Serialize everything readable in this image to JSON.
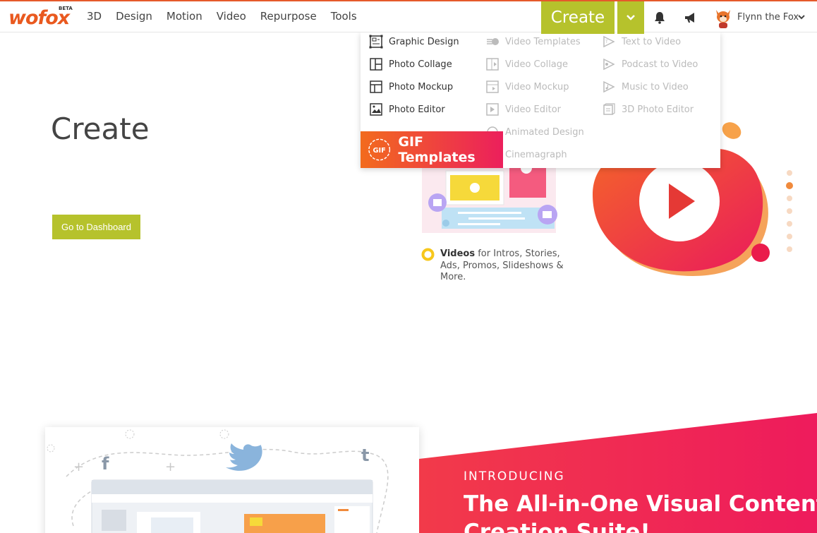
{
  "brand": {
    "logo": "wofox",
    "beta": "BETA"
  },
  "nav": [
    "3D",
    "Design",
    "Motion",
    "Video",
    "Repurpose",
    "Tools"
  ],
  "create_label": "Create",
  "user": {
    "name": "Flynn the Fox"
  },
  "hero": {
    "title": "Create",
    "dashboard_button": "Go to Dashboard"
  },
  "dropdown": {
    "col1": [
      "Graphic Design",
      "Photo Collage",
      "Photo Mockup",
      "Photo Editor"
    ],
    "col2": [
      "Video Templates",
      "Video Collage",
      "Video Mockup",
      "Video Editor",
      "Animated Design",
      "Cinemagraph"
    ],
    "col3": [
      "Text to Video",
      "Podcast to Video",
      "Music to Video",
      "3D Photo Editor"
    ],
    "gif": {
      "label": "GIF Templates",
      "icon_text": "GIF"
    }
  },
  "videos_blurb": {
    "bold": "Videos",
    "rest": " for Intros, Stories, Ads, Promos, Slideshows & More."
  },
  "banner": {
    "label": "INTRODUCING",
    "title_line1": "The All-in-One Visual Content",
    "title_line2": "Creation Suite!"
  },
  "colors": {
    "accent": "#b6c22c",
    "orange": "#f26b1d",
    "pink": "#ec1f5c"
  }
}
